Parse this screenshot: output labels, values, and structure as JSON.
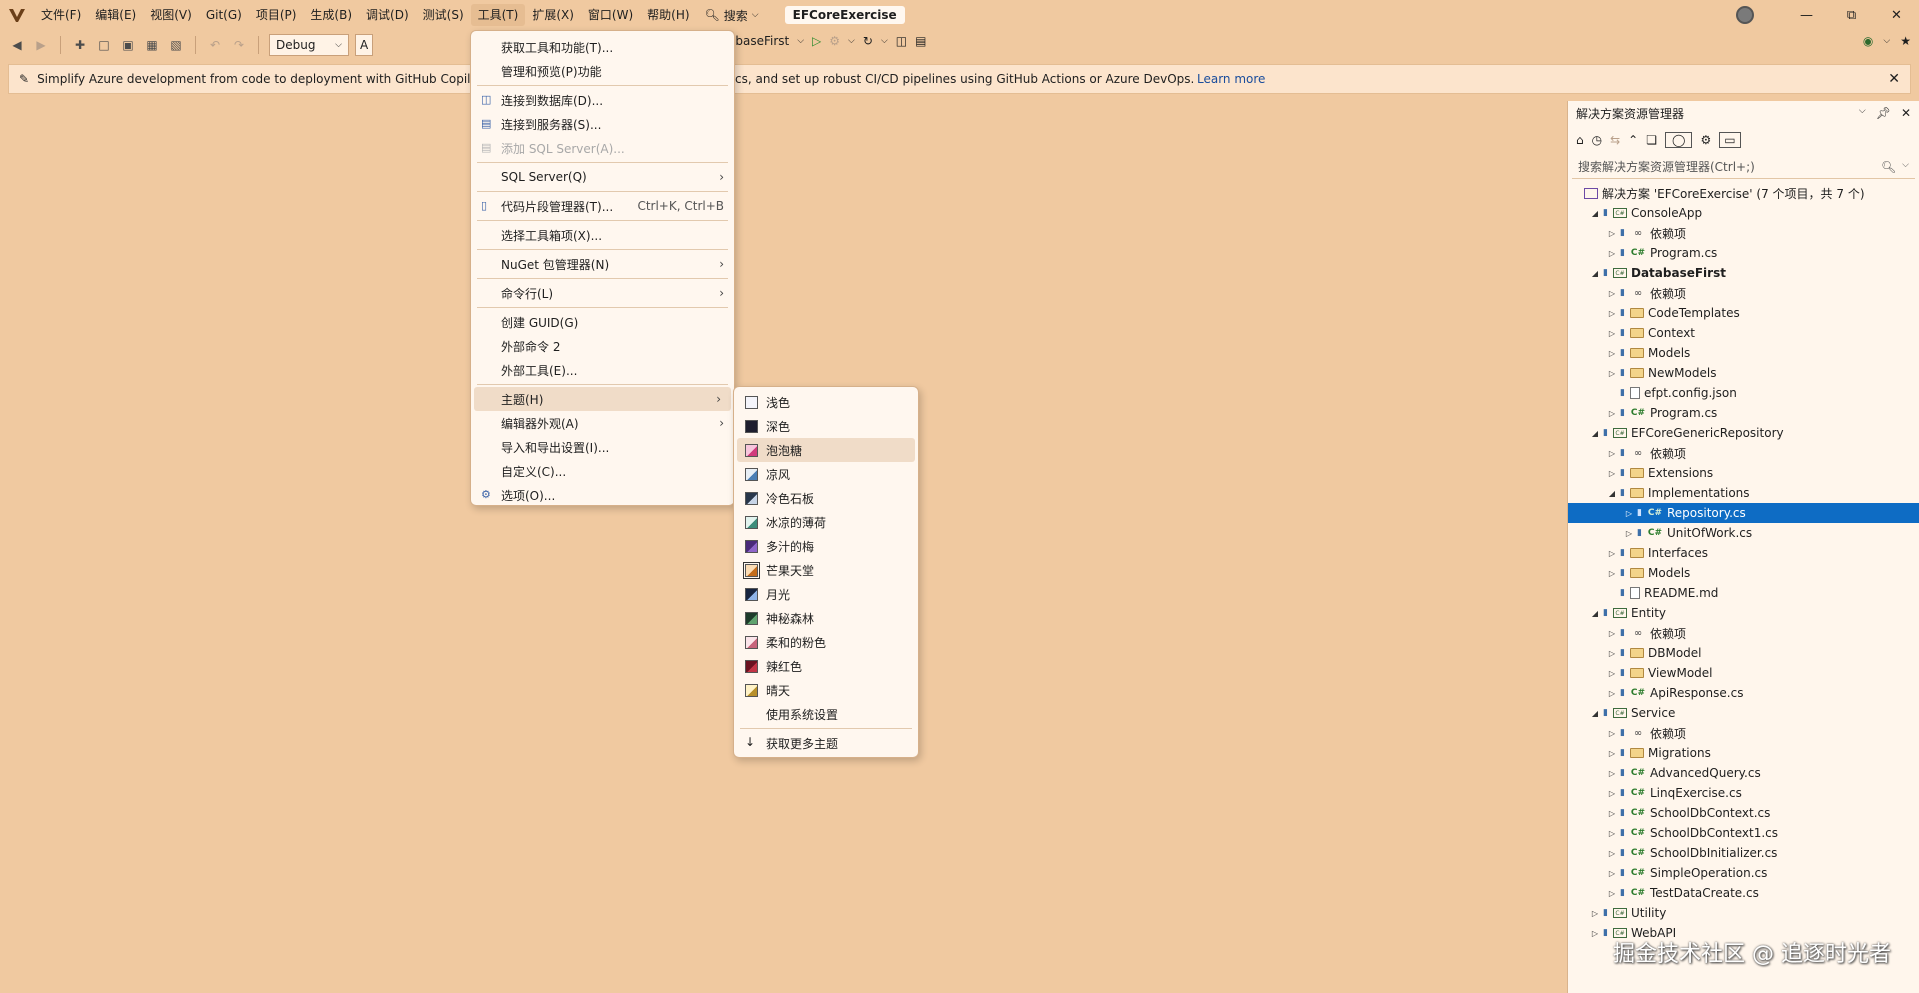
{
  "menubar": {
    "items": [
      "文件(F)",
      "编辑(E)",
      "视图(V)",
      "Git(G)",
      "项目(P)",
      "生成(B)",
      "调试(D)",
      "测试(S)",
      "工具(T)",
      "扩展(X)",
      "窗口(W)",
      "帮助(H)"
    ],
    "search_label": "搜索",
    "solution_name": "EFCoreExercise"
  },
  "toolbar": {
    "config": "Debug",
    "config_prefix": "A",
    "startup_project": "abaseFirst"
  },
  "infobar": {
    "text_left": "Simplify Azure development from code to deployment with GitHub Copilot",
    "text_right": "cs, and set up robust CI/CD pipelines using GitHub Actions or Azure DevOps.",
    "link": "Learn more"
  },
  "tools_menu": {
    "items": [
      {
        "label": "获取工具和功能(T)...",
        "shortcut": "",
        "submenu": false,
        "disabled": false,
        "icon": ""
      },
      {
        "label": "管理和预览(P)功能",
        "shortcut": "",
        "submenu": false,
        "disabled": false,
        "icon": ""
      },
      {
        "label": "连接到数据库(D)...",
        "shortcut": "",
        "submenu": false,
        "disabled": false,
        "icon": "database-icon"
      },
      {
        "label": "连接到服务器(S)...",
        "shortcut": "",
        "submenu": false,
        "disabled": false,
        "icon": "server-icon"
      },
      {
        "label": "添加 SQL Server(A)...",
        "shortcut": "",
        "submenu": false,
        "disabled": true,
        "icon": "sql-server-icon"
      },
      {
        "label": "SQL Server(Q)",
        "shortcut": "",
        "submenu": true,
        "disabled": false,
        "icon": ""
      },
      {
        "label": "代码片段管理器(T)...",
        "shortcut": "Ctrl+K, Ctrl+B",
        "submenu": false,
        "disabled": false,
        "icon": "snippet-icon"
      },
      {
        "label": "选择工具箱项(X)...",
        "shortcut": "",
        "submenu": false,
        "disabled": false,
        "icon": ""
      },
      {
        "label": "NuGet 包管理器(N)",
        "shortcut": "",
        "submenu": true,
        "disabled": false,
        "icon": ""
      },
      {
        "label": "命令行(L)",
        "shortcut": "",
        "submenu": true,
        "disabled": false,
        "icon": ""
      },
      {
        "label": "创建 GUID(G)",
        "shortcut": "",
        "submenu": false,
        "disabled": false,
        "icon": ""
      },
      {
        "label": "外部命令 2",
        "shortcut": "",
        "submenu": false,
        "disabled": false,
        "icon": ""
      },
      {
        "label": "外部工具(E)...",
        "shortcut": "",
        "submenu": false,
        "disabled": false,
        "icon": ""
      },
      {
        "label": "主题(H)",
        "shortcut": "",
        "submenu": true,
        "disabled": false,
        "icon": ""
      },
      {
        "label": "编辑器外观(A)",
        "shortcut": "",
        "submenu": true,
        "disabled": false,
        "icon": ""
      },
      {
        "label": "导入和导出设置(I)...",
        "shortcut": "",
        "submenu": false,
        "disabled": false,
        "icon": ""
      },
      {
        "label": "自定义(C)...",
        "shortcut": "",
        "submenu": false,
        "disabled": false,
        "icon": ""
      },
      {
        "label": "选项(O)...",
        "shortcut": "",
        "submenu": false,
        "disabled": false,
        "icon": "gear-icon"
      }
    ]
  },
  "theme_menu": {
    "items": [
      {
        "label": "浅色",
        "color": "#f4f4fa",
        "accent": "#f4f4fa"
      },
      {
        "label": "深色",
        "color": "#1e1e2e",
        "accent": "#1e1e2e"
      },
      {
        "label": "泡泡糖",
        "color": "#f7c6dc",
        "accent": "#d13b7c"
      },
      {
        "label": "凉风",
        "color": "#e7eef5",
        "accent": "#4b7fb5"
      },
      {
        "label": "冷色石板",
        "color": "#28364a",
        "accent": "#c7d4e6"
      },
      {
        "label": "冰凉的薄荷",
        "color": "#e2f3ee",
        "accent": "#3c8d7b"
      },
      {
        "label": "多汁的梅",
        "color": "#4a2a7a",
        "accent": "#8e65c9"
      },
      {
        "label": "芒果天堂",
        "color": "#fbdcb4",
        "accent": "#c46d1c"
      },
      {
        "label": "月光",
        "color": "#17243f",
        "accent": "#8fb4e8"
      },
      {
        "label": "神秘森林",
        "color": "#1d3b2a",
        "accent": "#5fa36e"
      },
      {
        "label": "柔和的粉色",
        "color": "#fbe5ea",
        "accent": "#c7647b"
      },
      {
        "label": "辣红色",
        "color": "#6b1220",
        "accent": "#c23445"
      },
      {
        "label": "晴天",
        "color": "#fff2c6",
        "accent": "#b8902b"
      },
      {
        "label": "使用系统设置",
        "color": "",
        "accent": ""
      }
    ],
    "more": "获取更多主题"
  },
  "solution_explorer": {
    "title": "解决方案资源管理器",
    "search_placeholder": "搜索解决方案资源管理器(Ctrl+;)",
    "tree": [
      {
        "label": "解决方案 'EFCoreExercise' (7 个项目，共 7 个)",
        "indent": 0,
        "type": "sol",
        "exp": "",
        "bold": false
      },
      {
        "label": "ConsoleApp",
        "indent": 1,
        "type": "proj",
        "exp": "open",
        "bold": false
      },
      {
        "label": "依赖项",
        "indent": 2,
        "type": "dep",
        "exp": "closed",
        "bold": false
      },
      {
        "label": "Program.cs",
        "indent": 2,
        "type": "cs",
        "exp": "closed",
        "bold": false
      },
      {
        "label": "DatabaseFirst",
        "indent": 1,
        "type": "proj",
        "exp": "open",
        "bold": true
      },
      {
        "label": "依赖项",
        "indent": 2,
        "type": "dep",
        "exp": "closed",
        "bold": false
      },
      {
        "label": "CodeTemplates",
        "indent": 2,
        "type": "folder",
        "exp": "closed",
        "bold": false
      },
      {
        "label": "Context",
        "indent": 2,
        "type": "folder",
        "exp": "closed",
        "bold": false
      },
      {
        "label": "Models",
        "indent": 2,
        "type": "folder",
        "exp": "closed",
        "bold": false
      },
      {
        "label": "NewModels",
        "indent": 2,
        "type": "folder",
        "exp": "closed",
        "bold": false
      },
      {
        "label": "efpt.config.json",
        "indent": 2,
        "type": "file",
        "exp": "",
        "bold": false
      },
      {
        "label": "Program.cs",
        "indent": 2,
        "type": "cs",
        "exp": "closed",
        "bold": false
      },
      {
        "label": "EFCoreGenericRepository",
        "indent": 1,
        "type": "proj",
        "exp": "open",
        "bold": false
      },
      {
        "label": "依赖项",
        "indent": 2,
        "type": "dep",
        "exp": "closed",
        "bold": false
      },
      {
        "label": "Extensions",
        "indent": 2,
        "type": "folder",
        "exp": "closed",
        "bold": false
      },
      {
        "label": "Implementations",
        "indent": 2,
        "type": "folder",
        "exp": "open",
        "bold": false
      },
      {
        "label": "Repository.cs",
        "indent": 3,
        "type": "cs",
        "exp": "closed",
        "bold": false,
        "selected": true
      },
      {
        "label": "UnitOfWork.cs",
        "indent": 3,
        "type": "cs",
        "exp": "closed",
        "bold": false
      },
      {
        "label": "Interfaces",
        "indent": 2,
        "type": "folder",
        "exp": "closed",
        "bold": false
      },
      {
        "label": "Models",
        "indent": 2,
        "type": "folder",
        "exp": "closed",
        "bold": false
      },
      {
        "label": "README.md",
        "indent": 2,
        "type": "file",
        "exp": "",
        "bold": false
      },
      {
        "label": "Entity",
        "indent": 1,
        "type": "proj",
        "exp": "open",
        "bold": false
      },
      {
        "label": "依赖项",
        "indent": 2,
        "type": "dep",
        "exp": "closed",
        "bold": false
      },
      {
        "label": "DBModel",
        "indent": 2,
        "type": "folder",
        "exp": "closed",
        "bold": false
      },
      {
        "label": "ViewModel",
        "indent": 2,
        "type": "folder",
        "exp": "closed",
        "bold": false
      },
      {
        "label": "ApiResponse.cs",
        "indent": 2,
        "type": "cs",
        "exp": "closed",
        "bold": false
      },
      {
        "label": "Service",
        "indent": 1,
        "type": "proj",
        "exp": "open",
        "bold": false
      },
      {
        "label": "依赖项",
        "indent": 2,
        "type": "dep",
        "exp": "closed",
        "bold": false
      },
      {
        "label": "Migrations",
        "indent": 2,
        "type": "folder",
        "exp": "closed",
        "bold": false
      },
      {
        "label": "AdvancedQuery.cs",
        "indent": 2,
        "type": "cs",
        "exp": "closed",
        "bold": false
      },
      {
        "label": "LinqExercise.cs",
        "indent": 2,
        "type": "cs",
        "exp": "closed",
        "bold": false
      },
      {
        "label": "SchoolDbContext.cs",
        "indent": 2,
        "type": "cs",
        "exp": "closed",
        "bold": false
      },
      {
        "label": "SchoolDbContext1.cs",
        "indent": 2,
        "type": "cs",
        "exp": "closed",
        "bold": false
      },
      {
        "label": "SchoolDbInitializer.cs",
        "indent": 2,
        "type": "cs",
        "exp": "closed",
        "bold": false
      },
      {
        "label": "SimpleOperation.cs",
        "indent": 2,
        "type": "cs",
        "exp": "closed",
        "bold": false
      },
      {
        "label": "TestDataCreate.cs",
        "indent": 2,
        "type": "cs",
        "exp": "closed",
        "bold": false
      },
      {
        "label": "Utility",
        "indent": 1,
        "type": "proj",
        "exp": "closed",
        "bold": false
      },
      {
        "label": "WebAPI",
        "indent": 1,
        "type": "proj",
        "exp": "closed",
        "bold": false
      }
    ]
  },
  "watermark": "掘金技术社区 @ 追逐时光者"
}
